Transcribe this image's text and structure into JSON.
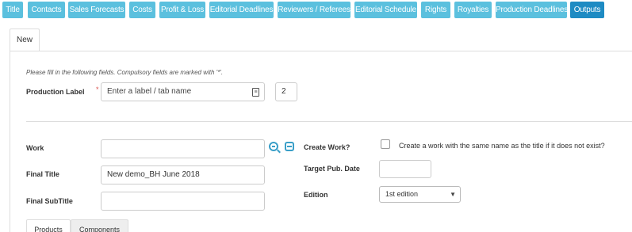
{
  "nav": {
    "items": [
      {
        "label": "Title"
      },
      {
        "label": "Contacts"
      },
      {
        "label": "Sales Forecasts"
      },
      {
        "label": "Costs"
      },
      {
        "label": "Profit & Loss"
      },
      {
        "label": "Editorial Deadlines"
      },
      {
        "label": "Reviewers / Referees"
      },
      {
        "label": "Editorial Schedule"
      },
      {
        "label": "Rights"
      },
      {
        "label": "Royalties"
      },
      {
        "label": "Production Deadlines"
      },
      {
        "label": "Outputs",
        "active": true
      }
    ]
  },
  "tabs": {
    "new_label": "New"
  },
  "form": {
    "instructions": "Please fill in the following fields. Compulsory fields are marked with '*'.",
    "production_label": {
      "label": "Production Label",
      "required_mark": "*",
      "placeholder": "Enter a label / tab name",
      "number": "2"
    },
    "work": {
      "label": "Work",
      "value": ""
    },
    "final_title": {
      "label": "Final Title",
      "value": "New demo_BH June 2018"
    },
    "final_subtitle": {
      "label": "Final SubTitle",
      "value": ""
    },
    "create_work": {
      "label": "Create Work?",
      "checkbox_text": "Create a work with the same name as the title if it does not exist?",
      "checked": false
    },
    "target_pub_date": {
      "label": "Target Pub. Date",
      "value": ""
    },
    "edition": {
      "label": "Edition",
      "selected": "1st edition"
    }
  },
  "subtabs": [
    {
      "label": "Products",
      "active": true
    },
    {
      "label": "Components",
      "active": false
    }
  ],
  "colors": {
    "nav_bg": "#5bc0de",
    "nav_active": "#1e8bc3",
    "icon": "#3a9fc8",
    "required": "#d9534f"
  },
  "icons": {
    "zoom": "zoom-in-icon",
    "remove": "minus-square-icon",
    "label_picker": "list-icon"
  }
}
